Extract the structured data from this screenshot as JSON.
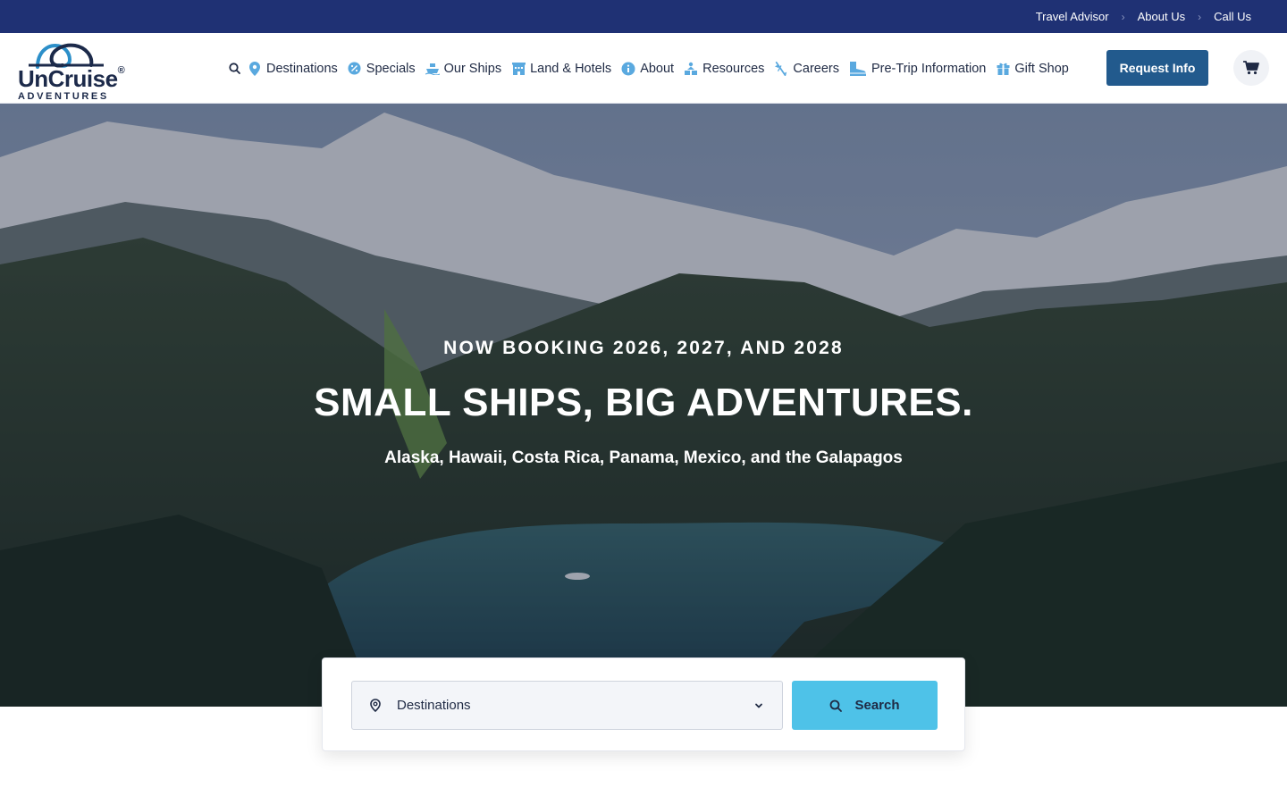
{
  "utility_bar": {
    "links": [
      "Travel Advisor",
      "About Us",
      "Call Us"
    ],
    "separator": "›",
    "bg_color": "#1f3174"
  },
  "logo": {
    "word": "UnCruise",
    "trademark": "®",
    "sub": "ADVENTURES"
  },
  "nav": {
    "search_icon": "search-icon",
    "items": [
      {
        "label": "Destinations",
        "icon": "map-pin-icon"
      },
      {
        "label": "Specials",
        "icon": "percent-badge-icon"
      },
      {
        "label": "Our Ships",
        "icon": "ship-icon"
      },
      {
        "label": "Land & Hotels",
        "icon": "hotel-icon"
      },
      {
        "label": "About",
        "icon": "info-icon"
      },
      {
        "label": "Resources",
        "icon": "resources-icon"
      },
      {
        "label": "Careers",
        "icon": "careers-icon"
      },
      {
        "label": "Pre-Trip Information",
        "icon": "boot-icon"
      },
      {
        "label": "Gift Shop",
        "icon": "gift-icon"
      }
    ],
    "icon_color": "#5aa9df"
  },
  "header": {
    "request_label": "Request Info",
    "cart_icon": "cart-icon",
    "accent": "#225a8d"
  },
  "hero": {
    "eyebrow": "NOW BOOKING 2026, 2027, AND 2028",
    "title": "SMALL SHIPS, BIG ADVENTURES.",
    "subtitle": "Alaska, Hawaii, Costa Rica, Panama, Mexico, and the Galapagos"
  },
  "search": {
    "destination_value": "Destinations",
    "button_label": "Search",
    "button_color": "#4ec2e8"
  }
}
